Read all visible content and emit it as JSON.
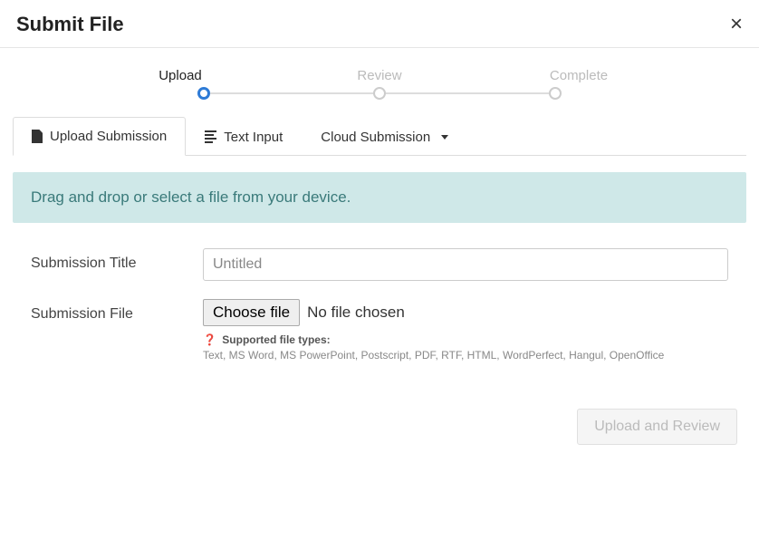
{
  "header": {
    "title": "Submit File"
  },
  "steps": {
    "upload": "Upload",
    "review": "Review",
    "complete": "Complete"
  },
  "tabs": {
    "upload_submission": "Upload Submission",
    "text_input": "Text Input",
    "cloud_submission": "Cloud Submission"
  },
  "banner": {
    "text": "Drag and drop or select a file from your device."
  },
  "form": {
    "title_label": "Submission Title",
    "title_value": "Untitled",
    "file_label": "Submission File",
    "choose_file": "Choose file",
    "no_file": "No file chosen",
    "supported_label": "Supported file types:",
    "supported_types": "Text, MS Word, MS PowerPoint, Postscript, PDF, RTF, HTML, WordPerfect, Hangul, OpenOffice"
  },
  "footer": {
    "upload_review": "Upload and Review"
  }
}
